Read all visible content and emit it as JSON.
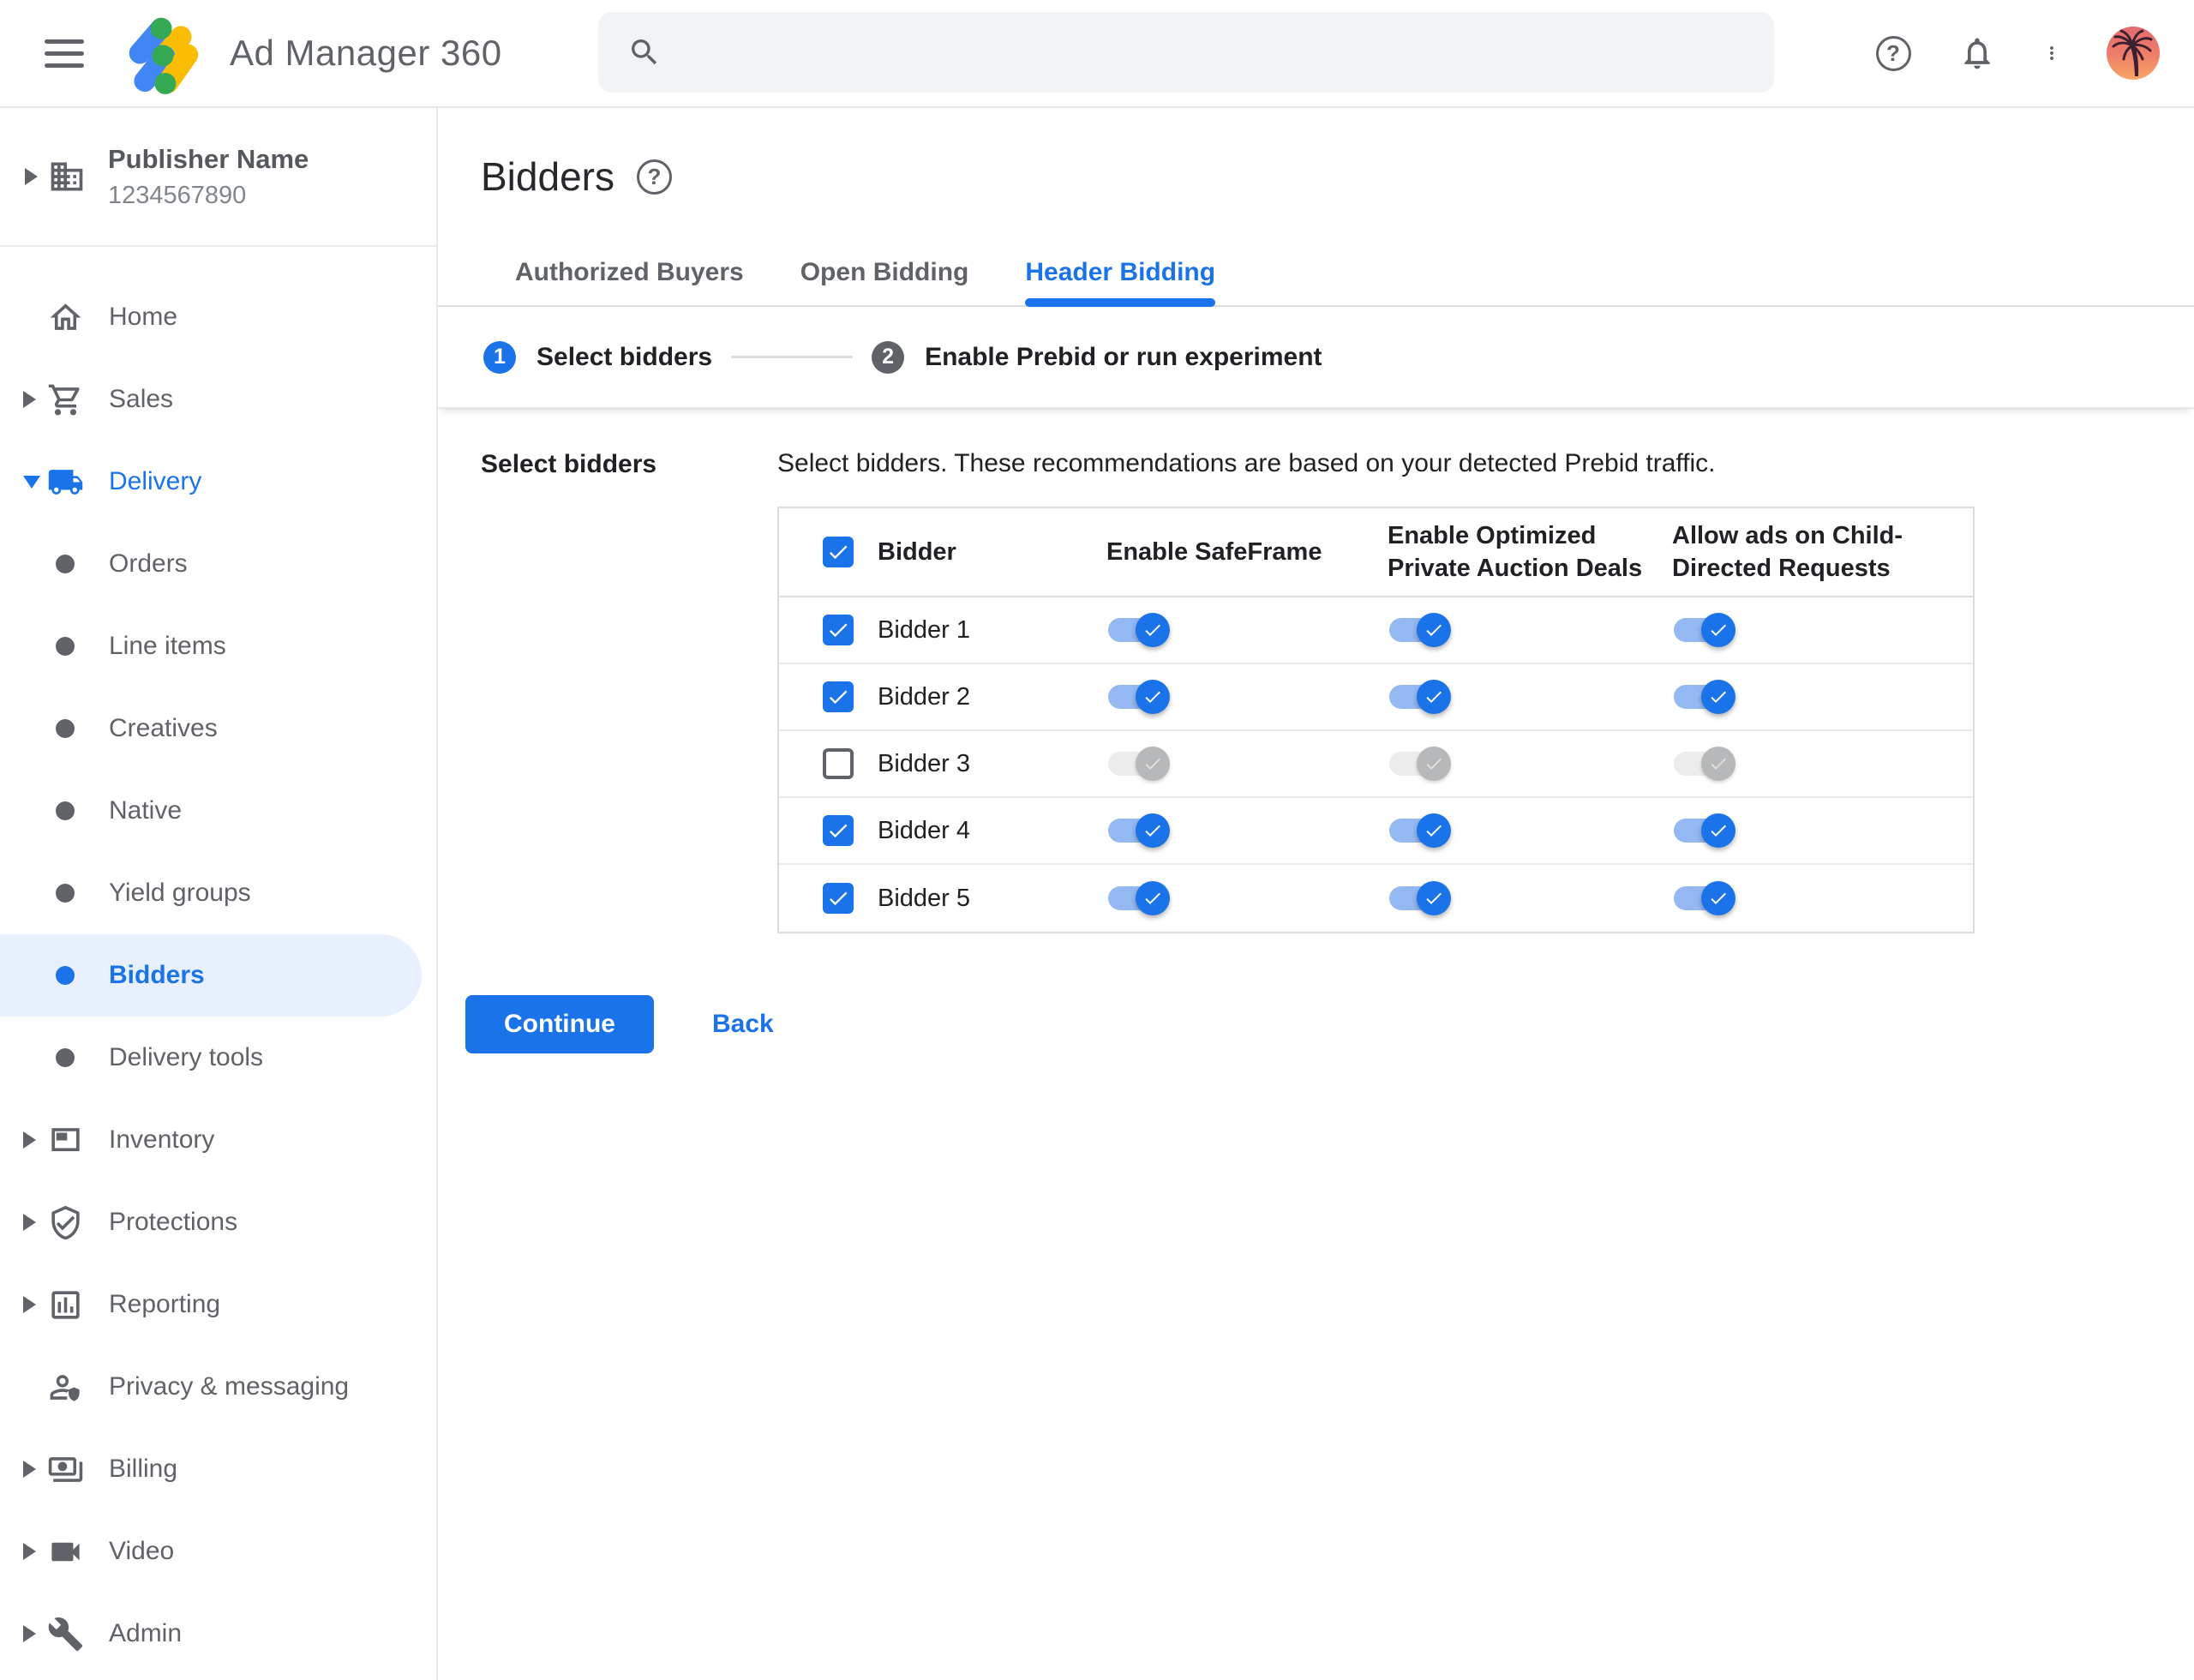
{
  "topbar": {
    "app_title": "Ad Manager 360",
    "search": {
      "value": "",
      "placeholder": ""
    }
  },
  "publisher": {
    "name": "Publisher Name",
    "id": "1234567890"
  },
  "sidebar": {
    "items": [
      {
        "label": "Home",
        "icon": "home-icon",
        "caret": "none",
        "style": "icon"
      },
      {
        "label": "Sales",
        "icon": "cart-icon",
        "caret": "right",
        "style": "icon"
      },
      {
        "label": "Delivery",
        "icon": "truck-icon",
        "caret": "down",
        "style": "icon",
        "active": true
      },
      {
        "label": "Orders",
        "style": "bullet"
      },
      {
        "label": "Line items",
        "style": "bullet"
      },
      {
        "label": "Creatives",
        "style": "bullet"
      },
      {
        "label": "Native",
        "style": "bullet"
      },
      {
        "label": "Yield groups",
        "style": "bullet"
      },
      {
        "label": "Bidders",
        "style": "bullet",
        "selected": true
      },
      {
        "label": "Delivery tools",
        "style": "bullet"
      },
      {
        "label": "Inventory",
        "icon": "window-icon",
        "caret": "right",
        "style": "icon"
      },
      {
        "label": "Protections",
        "icon": "shield-check-icon",
        "caret": "right",
        "style": "icon"
      },
      {
        "label": "Reporting",
        "icon": "bar-chart-icon",
        "caret": "right",
        "style": "icon"
      },
      {
        "label": "Privacy & messaging",
        "icon": "person-shield-icon",
        "caret": "none",
        "style": "icon"
      },
      {
        "label": "Billing",
        "icon": "money-icon",
        "caret": "right",
        "style": "icon"
      },
      {
        "label": "Video",
        "icon": "videocam-icon",
        "caret": "right",
        "style": "icon"
      },
      {
        "label": "Admin",
        "icon": "wrench-icon",
        "caret": "right",
        "style": "icon"
      }
    ]
  },
  "page": {
    "title": "Bidders",
    "help_icon": "help-circle-icon"
  },
  "tabs": [
    {
      "label": "Authorized Buyers",
      "active": false
    },
    {
      "label": "Open Bidding",
      "active": false
    },
    {
      "label": "Header Bidding",
      "active": true
    }
  ],
  "stepper": {
    "steps": [
      {
        "number": "1",
        "label": "Select bidders",
        "state": "active"
      },
      {
        "number": "2",
        "label": "Enable Prebid or run experiment",
        "state": "upcoming"
      }
    ]
  },
  "content": {
    "section_label": "Select bidders",
    "description": "Select bidders. These recommendations are based on your detected Prebid traffic.",
    "table": {
      "select_all_checked": true,
      "columns": [
        "Bidder",
        "Enable SafeFrame",
        "Enable Optimized Private Auction Deals",
        "Allow ads on Child-Directed Requests"
      ],
      "rows": [
        {
          "name": "Bidder 1",
          "selected": true,
          "toggles_disabled": false,
          "enable_safeframe": true,
          "enable_optimized_private_auction_deals": true,
          "allow_ads_on_child_directed_requests": true
        },
        {
          "name": "Bidder 2",
          "selected": true,
          "toggles_disabled": false,
          "enable_safeframe": true,
          "enable_optimized_private_auction_deals": true,
          "allow_ads_on_child_directed_requests": true
        },
        {
          "name": "Bidder 3",
          "selected": false,
          "toggles_disabled": true,
          "enable_safeframe": true,
          "enable_optimized_private_auction_deals": true,
          "allow_ads_on_child_directed_requests": true
        },
        {
          "name": "Bidder 4",
          "selected": true,
          "toggles_disabled": false,
          "enable_safeframe": true,
          "enable_optimized_private_auction_deals": true,
          "allow_ads_on_child_directed_requests": true
        },
        {
          "name": "Bidder 5",
          "selected": true,
          "toggles_disabled": false,
          "enable_safeframe": true,
          "enable_optimized_private_auction_deals": true,
          "allow_ads_on_child_directed_requests": true
        }
      ]
    },
    "actions": {
      "continue_label": "Continue",
      "back_label": "Back"
    }
  },
  "colors": {
    "accent_blue": "#1a73e8",
    "selected_nav_bg": "#e8f0fe",
    "toggle_track_on": "#94b8f1",
    "toggle_track_off": "#ececec",
    "toggle_thumb_off": "#b6b8ba",
    "search_bg": "#f1f3f4",
    "avatar_gradient_top": "#e4696f",
    "avatar_gradient_bottom": "#f9a765"
  }
}
